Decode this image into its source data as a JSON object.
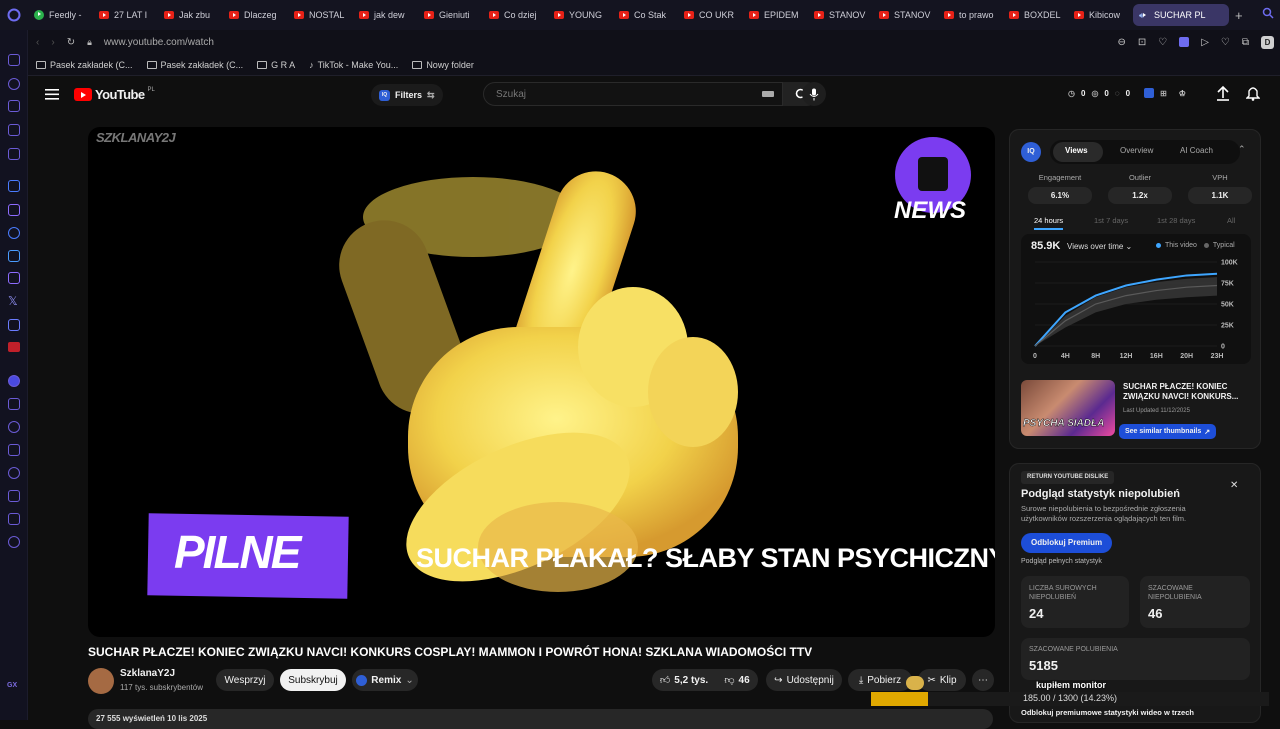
{
  "browser": {
    "tabs": [
      {
        "label": "Feedly -",
        "kind": "feedly"
      },
      {
        "label": "27 LAT I"
      },
      {
        "label": "Jak zbu"
      },
      {
        "label": "Dlaczeg"
      },
      {
        "label": "NOSTAL"
      },
      {
        "label": "jak dew"
      },
      {
        "label": "Gieniuti"
      },
      {
        "label": "Co dziej"
      },
      {
        "label": "YOUNG"
      },
      {
        "label": "Co Stak"
      },
      {
        "label": "CO UKR"
      },
      {
        "label": "EPIDEM"
      },
      {
        "label": "STANOV"
      },
      {
        "label": "STANOV"
      },
      {
        "label": "to prawo"
      },
      {
        "label": "BOXDEL"
      },
      {
        "label": "Kibicow"
      },
      {
        "label": "SUCHAR PL",
        "active": true
      }
    ],
    "new_tab": "+",
    "url": "www.youtube.com/watch",
    "profile_letter": "D",
    "bookmarks": [
      {
        "label": "Pasek zakładek (C...",
        "icon": "folder"
      },
      {
        "label": "Pasek zakładek (C...",
        "icon": "folder"
      },
      {
        "label": "G R A",
        "icon": "folder"
      },
      {
        "label": "TikTok - Make You...",
        "icon": "tiktok"
      },
      {
        "label": "Nowy folder",
        "icon": "folder"
      }
    ]
  },
  "youtube": {
    "logo_text": "YouTube",
    "logo_region": "PL",
    "filters_label": "Filters",
    "search_placeholder": "Szukaj",
    "counters": [
      "0",
      "0",
      "0"
    ]
  },
  "video": {
    "watermark": "SZKLANAY2J",
    "news_badge": "NEWS",
    "banner": "PILNE",
    "caption": "SUCHAR PŁAKAŁ? SŁABY STAN PSYCHICZNY!",
    "title": "SUCHAR PŁACZE! KONIEC ZWIĄZKU NAVCI! KONKURS COSPLAY! MAMMON I POWRÓT HONA! SZKLANA WIADOMOŚCI TTV"
  },
  "channel": {
    "name": "SzklanaY2J",
    "subscribers": "117 tys. subskrybentów",
    "support_label": "Wesprzyj",
    "subscribe_label": "Subskrybuj",
    "remix_label": "Remix",
    "likes": "5,2 tys.",
    "dislikes": "46",
    "share_label": "Udostępnij",
    "download_label": "Pobierz",
    "clip_label": "Klip",
    "views_partial": "27 555 wyświetleń  10 lis 2025"
  },
  "analytics": {
    "tabs": [
      "Views",
      "Overview",
      "AI Coach"
    ],
    "active_tab": "Views",
    "metrics": [
      {
        "label": "Engagement",
        "value": "6.1%"
      },
      {
        "label": "Outlier",
        "value": "1.2x"
      },
      {
        "label": "VPH",
        "value": "1.1K"
      }
    ],
    "ranges": [
      "24 hours",
      "1st 7 days",
      "1st 28 days",
      "All"
    ],
    "active_range": "24 hours",
    "total_views": "85.9K",
    "views_over_time_label": "Views over time",
    "legend": [
      "This video",
      "Typical"
    ],
    "similar": {
      "title": "SUCHAR PŁACZE! KONIEC ZWIĄZKU NAVCI! KONKURS...",
      "updated": "Last Updated 11/12/2025",
      "button": "See similar thumbnails",
      "thumb_text": "PSYCHA SIADŁA"
    }
  },
  "chart_data": {
    "type": "area",
    "x": [
      "0",
      "4H",
      "8H",
      "12H",
      "16H",
      "20H",
      "23H"
    ],
    "ytick_labels": [
      "0",
      "25K",
      "50K",
      "75K",
      "100K"
    ],
    "ylim": [
      0,
      100000
    ],
    "series": [
      {
        "name": "This video",
        "values": [
          0,
          40000,
          60000,
          72000,
          79000,
          84000,
          86000
        ],
        "color": "#3ea6ff"
      },
      {
        "name": "Typical",
        "values": [
          0,
          30000,
          50000,
          60000,
          66000,
          70000,
          72000
        ],
        "color": "#5a5a5a"
      }
    ],
    "typical_band": {
      "low": [
        0,
        22000,
        40000,
        50000,
        55000,
        58000,
        60000
      ],
      "high": [
        0,
        36000,
        58000,
        70000,
        76000,
        80000,
        82000
      ]
    },
    "grid": true,
    "legend": "top-right"
  },
  "dislike": {
    "badge": "RETURN YOUTUBE DISLIKE",
    "title": "Podgląd statystyk niepolubień",
    "desc": "Surowe niepolubienia to bezpośrednie zgłoszenia użytkowników rozszerzenia oglądających ten film.",
    "premium_button": "Odblokuj Premium",
    "full_stats_link": "Podgląd pełnych statystyk",
    "raw_label": "LICZBA SUROWYCH NIEPOLUBIEŃ",
    "raw_value": "24",
    "est_label": "SZACOWANE NIEPOLUBIENIA",
    "est_value": "46",
    "likes_label": "SZACOWANE POLUBIENIA",
    "likes_value": "5185",
    "premium_note": "Odblokuj premiumowe statystyki wideo w trzech"
  },
  "overlay": {
    "goal_title": "kupiłem monitor",
    "goal_progress_text": "185.00 / 1300 (14.23%)",
    "goal_fraction": 0.1423
  }
}
